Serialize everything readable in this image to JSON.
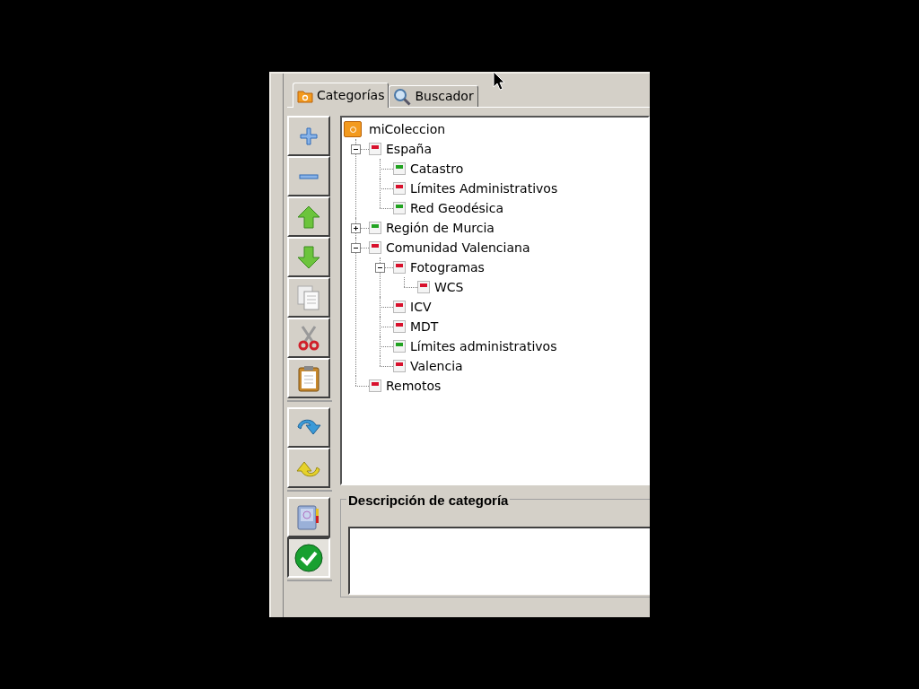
{
  "tabs": [
    {
      "label": "Categorías",
      "kind": "folder",
      "selected": true
    },
    {
      "label": "Buscador",
      "kind": "search",
      "selected": false
    }
  ],
  "toolbar_groups": [
    [
      {
        "kind": "add",
        "pressed": false
      },
      {
        "kind": "remove",
        "pressed": false
      },
      {
        "kind": "up",
        "pressed": false
      },
      {
        "kind": "down",
        "pressed": false
      },
      {
        "kind": "copy",
        "pressed": false
      },
      {
        "kind": "cut",
        "pressed": false
      },
      {
        "kind": "paste",
        "pressed": false
      }
    ],
    [
      {
        "kind": "redo",
        "pressed": false
      },
      {
        "kind": "undo",
        "pressed": false
      }
    ],
    [
      {
        "kind": "book",
        "pressed": false
      },
      {
        "kind": "check",
        "pressed": true
      }
    ]
  ],
  "tree": {
    "label": "miColeccion",
    "children": [
      {
        "label": "España",
        "color": "#d8102c",
        "expanded": true,
        "children": [
          {
            "label": "Catastro",
            "color": "#21a321"
          },
          {
            "label": "Límites Administrativos",
            "color": "#d8102c"
          },
          {
            "label": "Red Geodésica",
            "color": "#21a321"
          }
        ]
      },
      {
        "label": "Región de Murcia",
        "color": "#21a321",
        "expanded": false
      },
      {
        "label": "Comunidad Valenciana",
        "color": "#d8102c",
        "expanded": true,
        "children": [
          {
            "label": "Fotogramas",
            "color": "#d8102c",
            "expanded": true,
            "children": [
              {
                "label": "WCS",
                "color": "#d8102c"
              }
            ]
          },
          {
            "label": "ICV",
            "color": "#d8102c"
          },
          {
            "label": "MDT",
            "color": "#d8102c"
          },
          {
            "label": "Límites administrativos",
            "color": "#21a321"
          },
          {
            "label": "Valencia",
            "color": "#d8102c"
          }
        ]
      },
      {
        "label": "Remotos",
        "color": "#d8102c"
      }
    ]
  },
  "description": {
    "title": "Descripción de categoría"
  }
}
